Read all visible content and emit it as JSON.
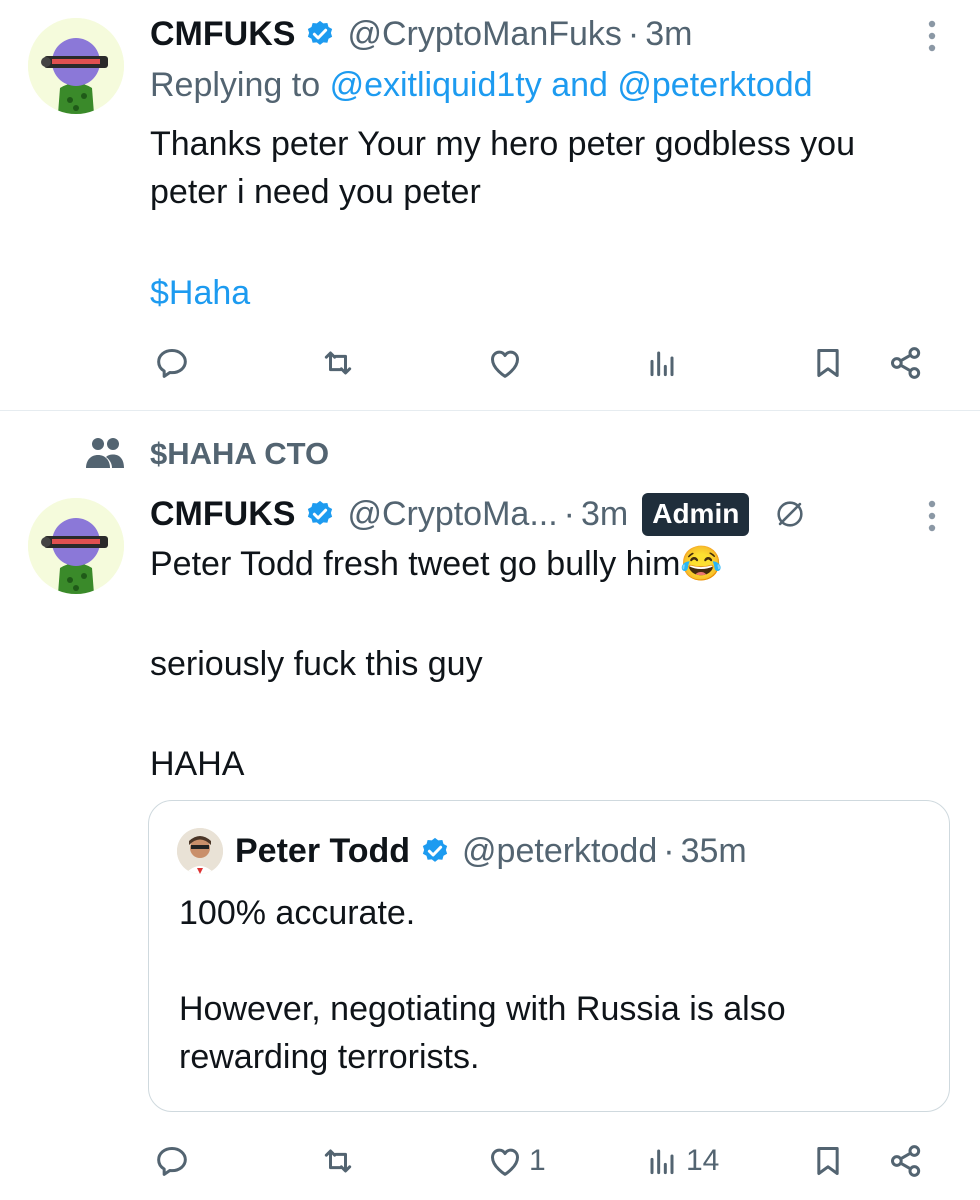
{
  "colors": {
    "accent": "#1d9bf0",
    "muted": "#536471",
    "text": "#0f1419",
    "admin_bg": "#1f2e3b"
  },
  "tweet1": {
    "name": "CMFUKS",
    "handle": "@CryptoManFuks",
    "time": "3m",
    "replying_prefix": "Replying to",
    "reply_user1": "@exitliquid1ty",
    "reply_and": "and",
    "reply_user2": "@peterktodd",
    "line1": "Thanks peter Your my hero peter godbless you",
    "line2": "peter i need you peter",
    "cashtag": "$Haha",
    "icons": [
      "reply-icon",
      "retweet-icon",
      "like-icon",
      "views-icon",
      "bookmark-icon",
      "share-icon"
    ]
  },
  "community": {
    "name": "$HAHA CTO",
    "icon": "community-icon"
  },
  "tweet2": {
    "name": "CMFUKS",
    "handle": "@CryptoMa...",
    "time": "3m",
    "role_badge": "Admin",
    "line1": "Peter Todd fresh tweet go bully him😂",
    "line2": "seriously fuck this guy",
    "line3": "HAHA",
    "quote": {
      "name": "Peter Todd",
      "handle": "@peterktodd",
      "time": "35m",
      "line1": "100% accurate.",
      "line2": "However, negotiating with Russia is also",
      "line3": "rewarding terrorists."
    },
    "actions": {
      "reply_count": "",
      "retweet_count": "",
      "like_count": "1",
      "views_count": "14"
    }
  }
}
